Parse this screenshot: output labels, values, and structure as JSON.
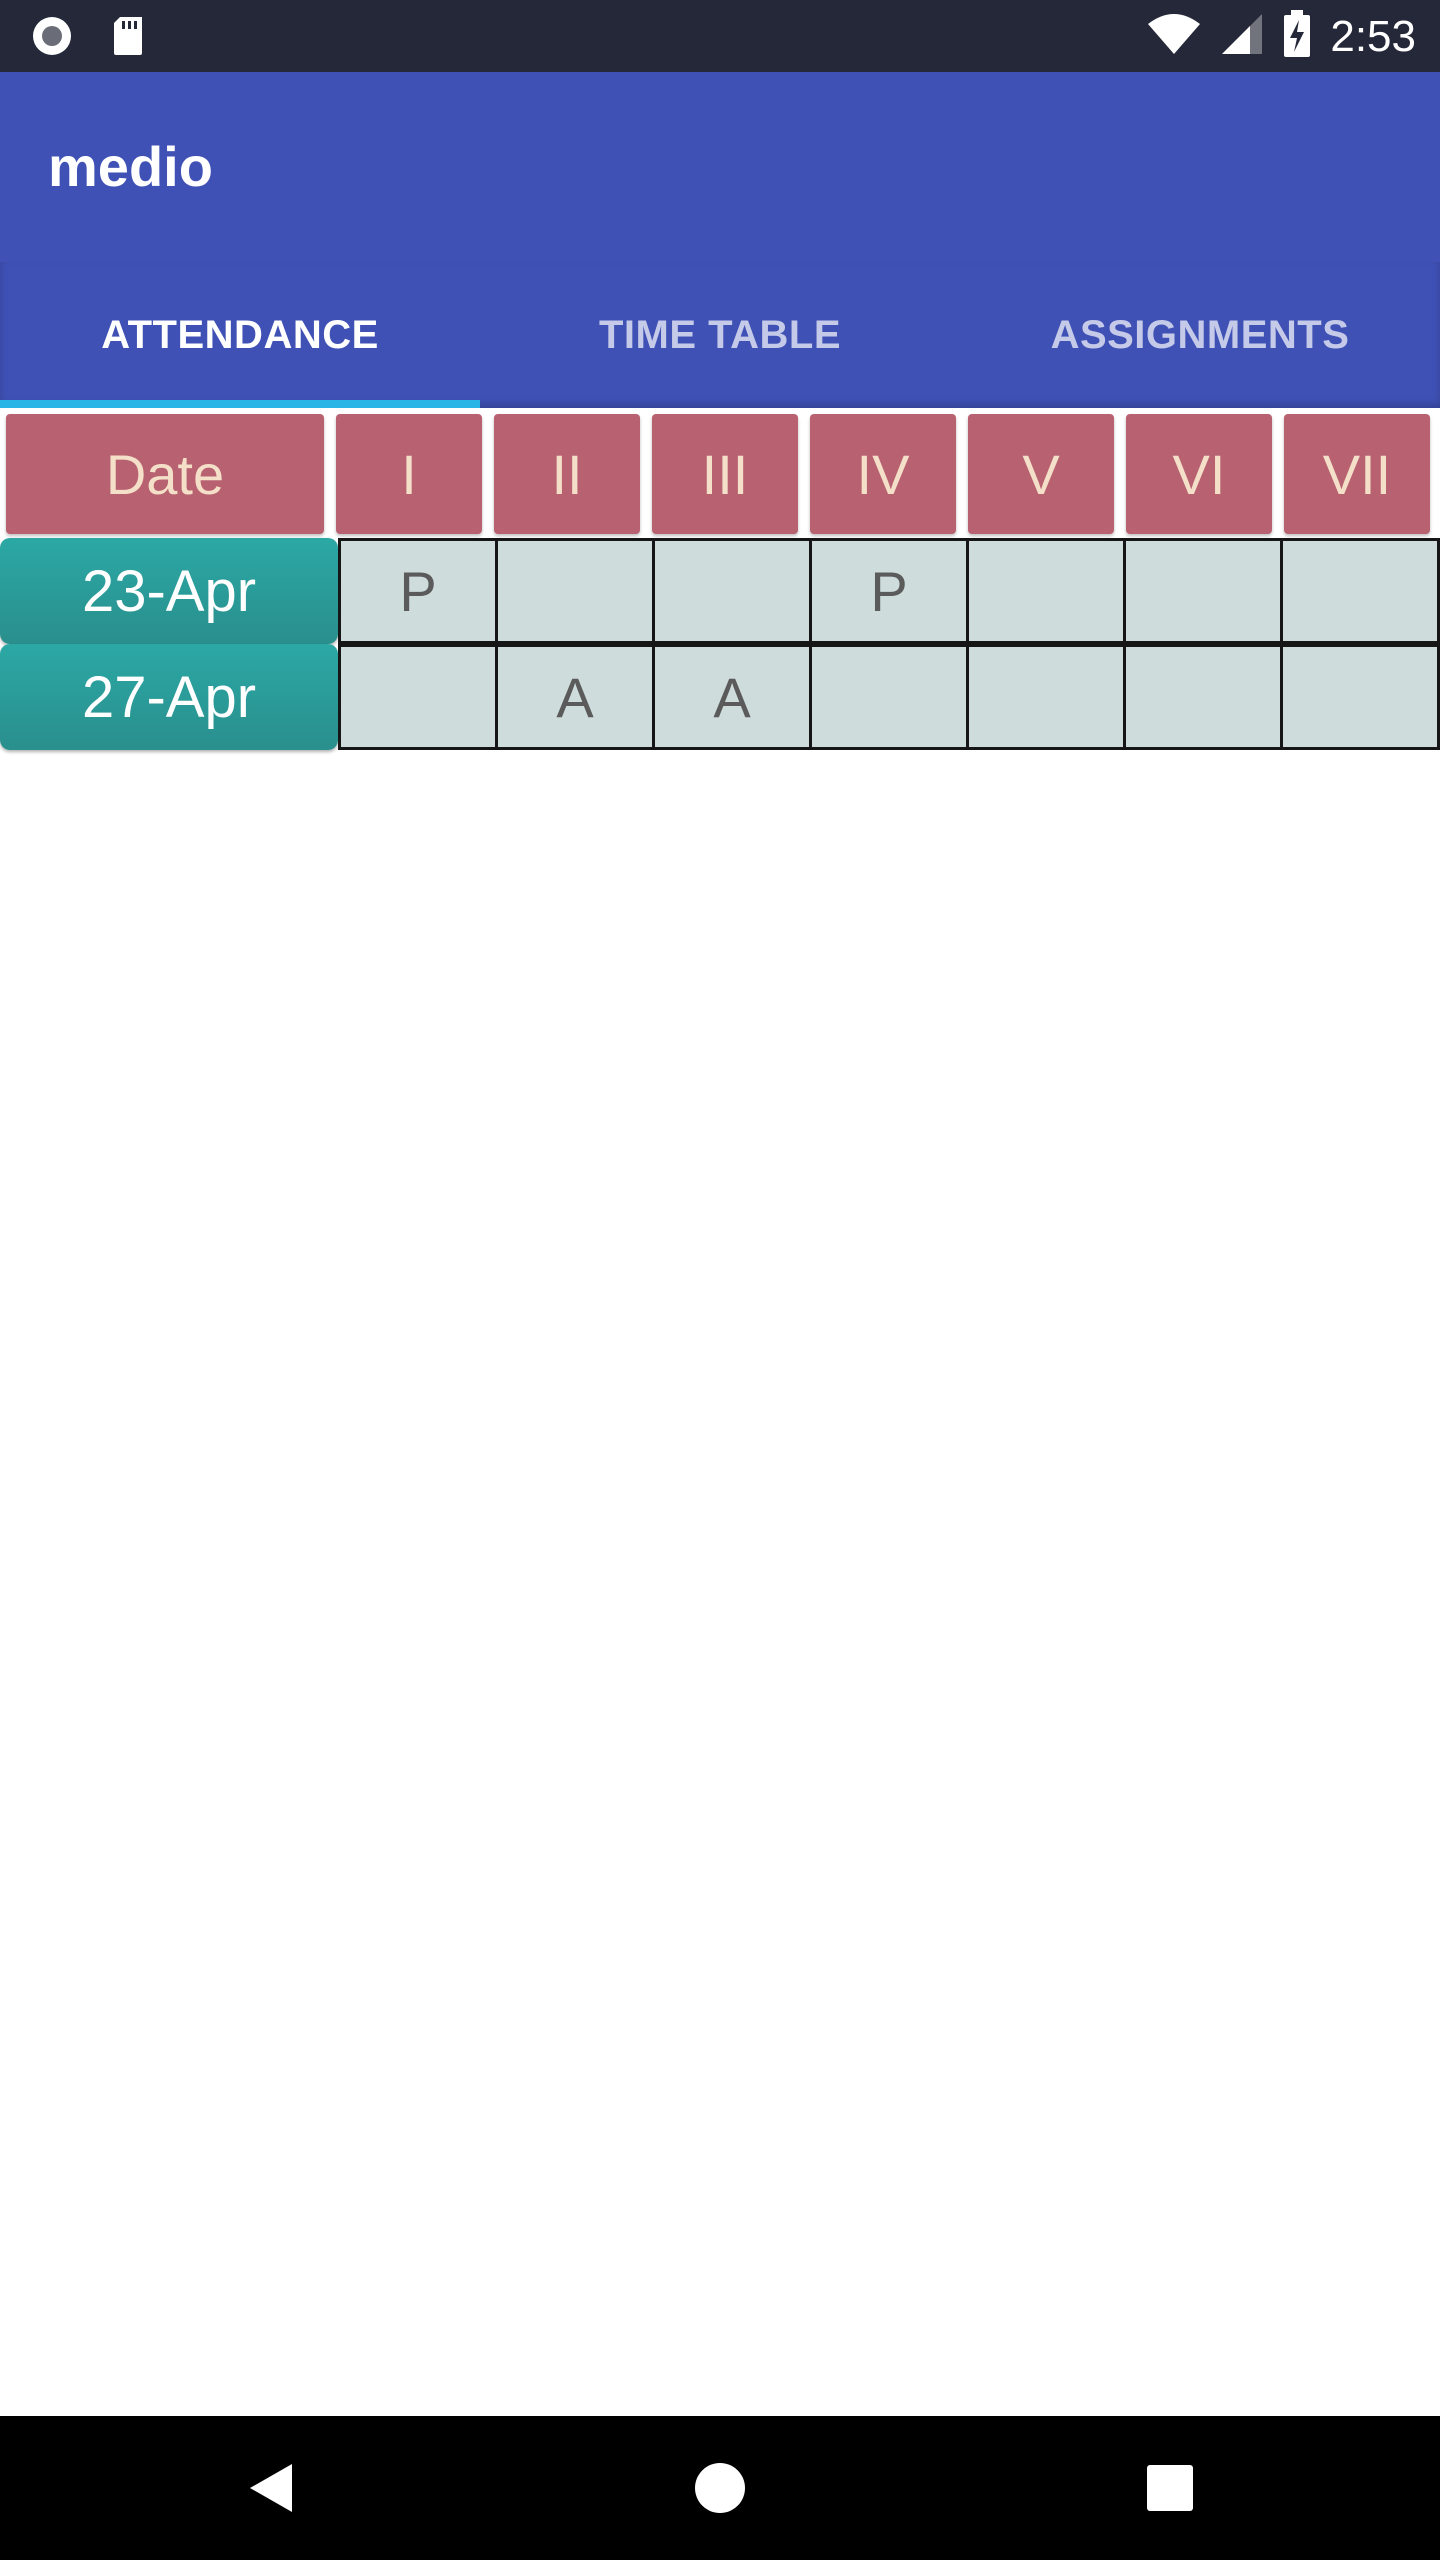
{
  "status_bar": {
    "time": "2:53",
    "icons": [
      "record-icon",
      "sd-card-icon",
      "wifi-icon",
      "signal-icon",
      "battery-charging-icon"
    ]
  },
  "app_bar": {
    "title": "medio"
  },
  "tabs": [
    {
      "label": "ATTENDANCE",
      "active": true
    },
    {
      "label": "TIME TABLE",
      "active": false
    },
    {
      "label": "ASSIGNMENTS",
      "active": false
    }
  ],
  "attendance": {
    "headers": [
      "Date",
      "I",
      "II",
      "III",
      "IV",
      "V",
      "VI",
      "VII"
    ],
    "rows": [
      {
        "date": "23-Apr",
        "marks": [
          "P",
          "",
          "",
          "P",
          "",
          "",
          ""
        ]
      },
      {
        "date": "27-Apr",
        "marks": [
          "",
          "A",
          "A",
          "",
          "",
          "",
          ""
        ]
      }
    ]
  },
  "nav_bar": {
    "icons": [
      "back-icon",
      "home-icon",
      "recents-icon"
    ]
  },
  "colors": {
    "primary": "#3f51b5",
    "status_bar": "#252838",
    "tab_indicator": "#29b6e6",
    "header_cell": "#b86170",
    "date_cell": "#2ba8a5",
    "att_cell": "#cfdcdc"
  }
}
